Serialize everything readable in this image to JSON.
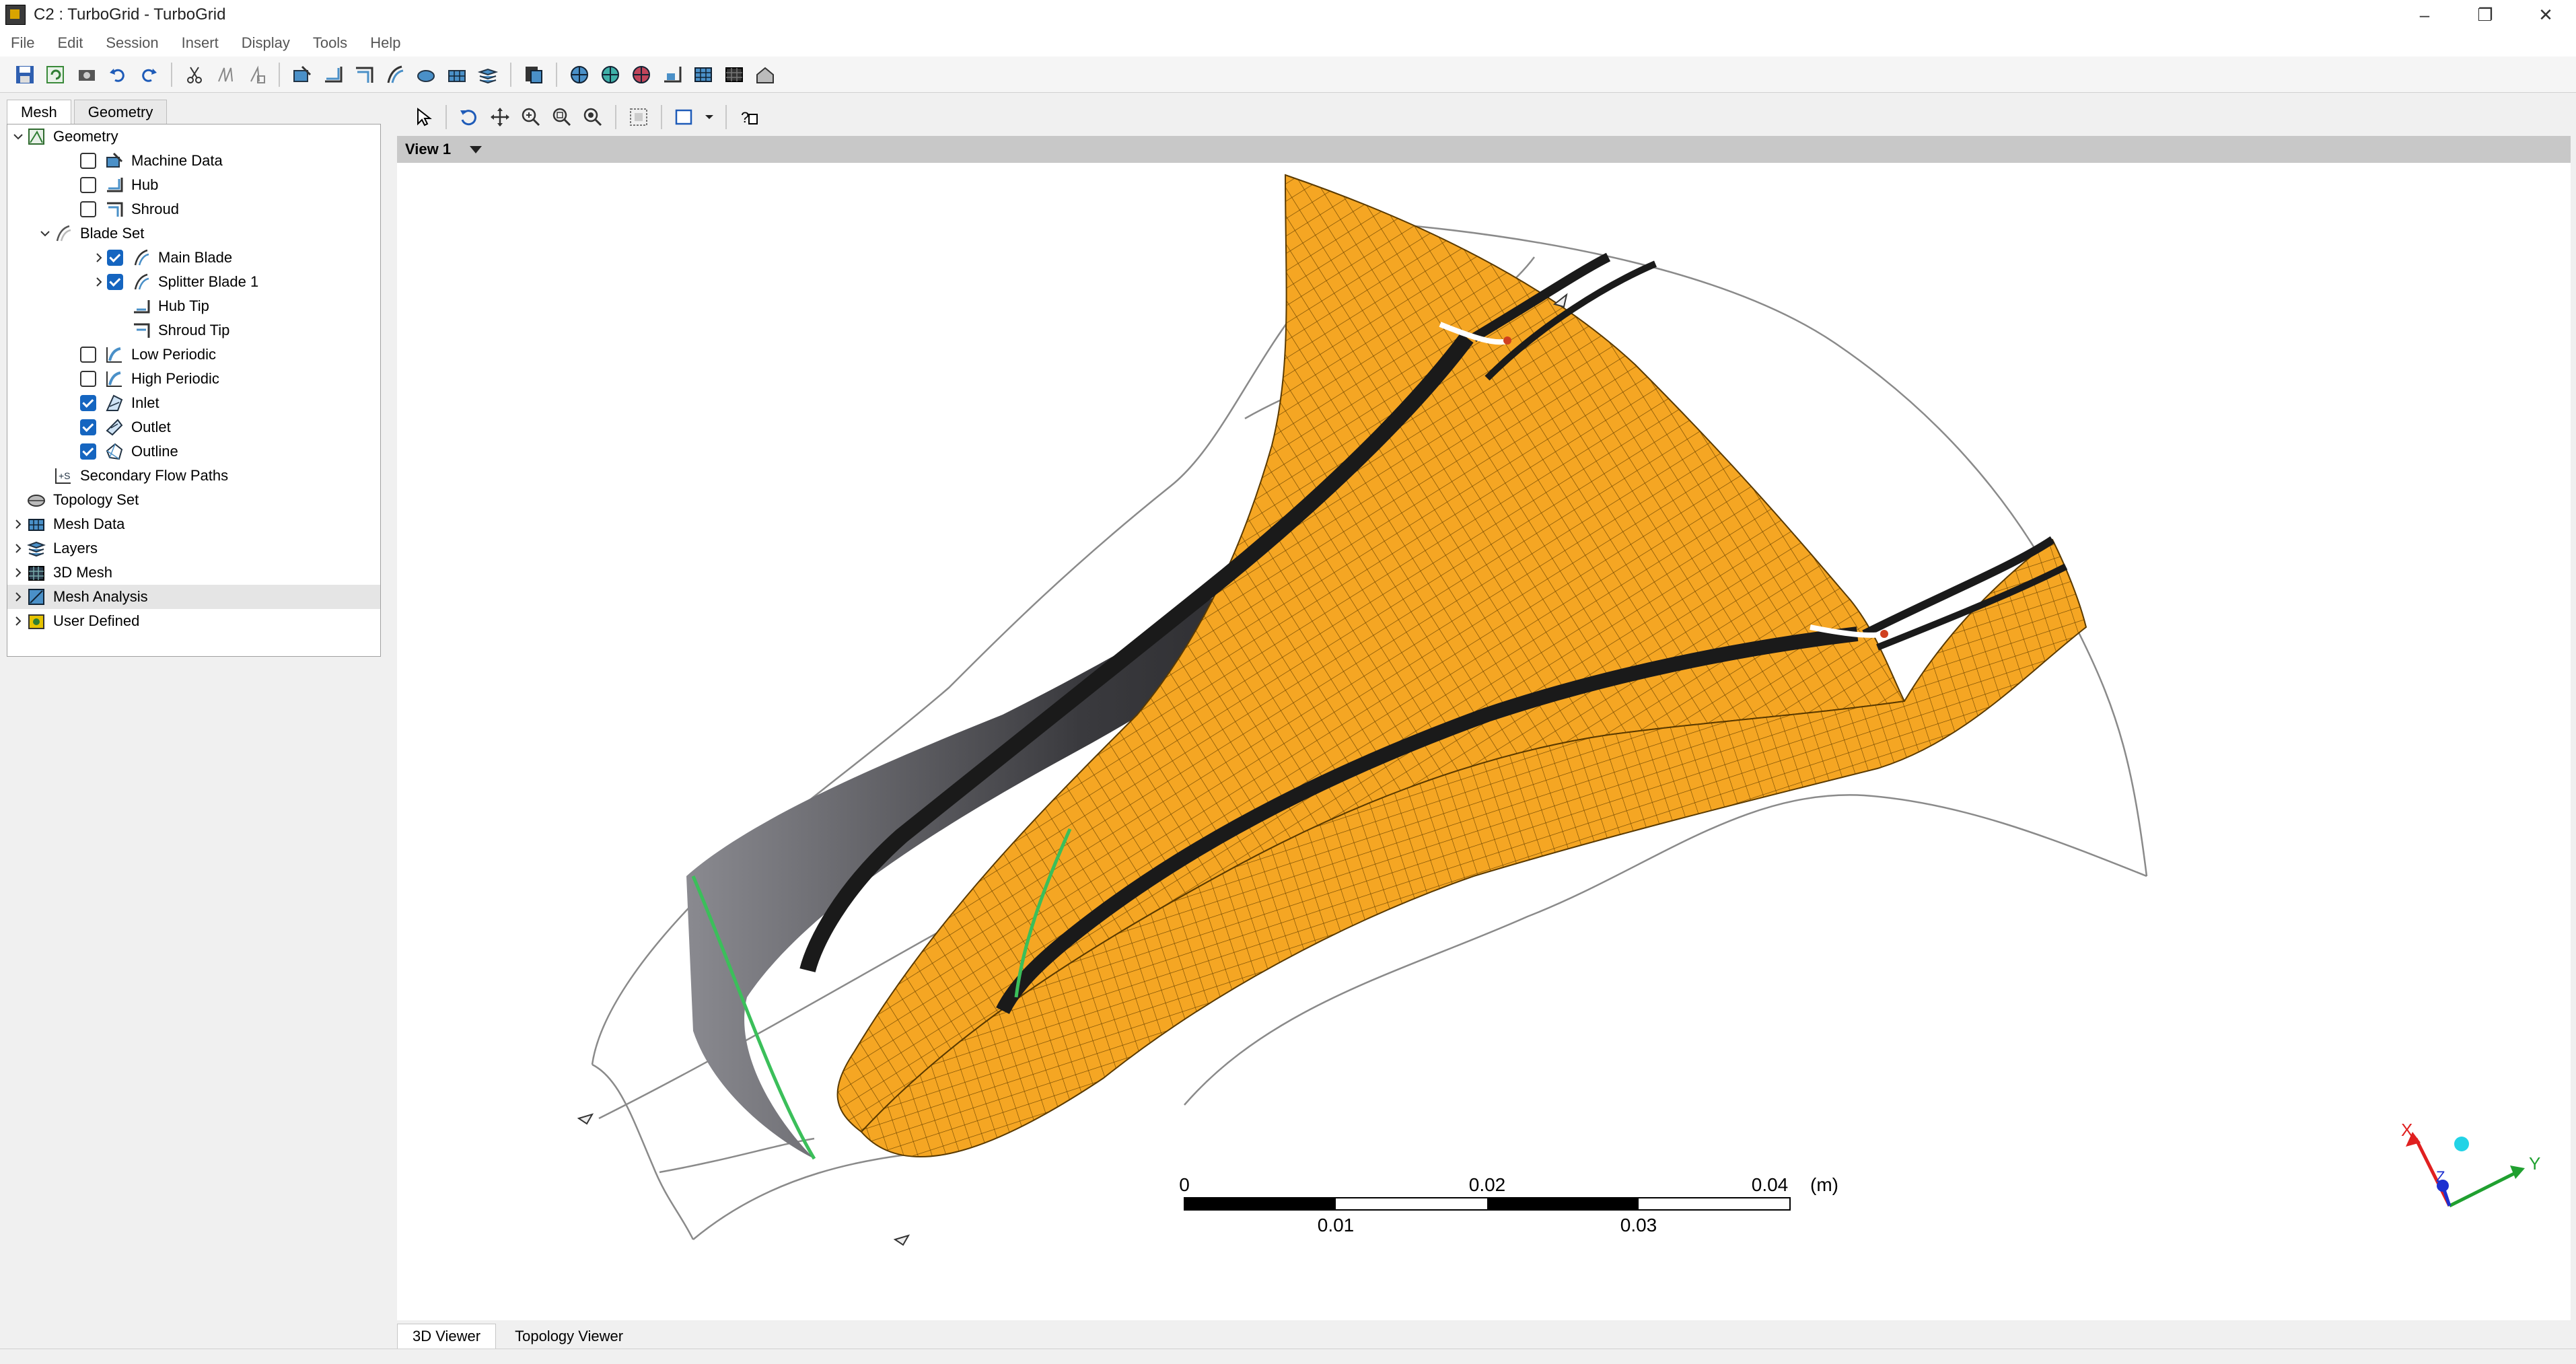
{
  "window": {
    "title": "C2 : TurboGrid - TurboGrid",
    "controls": [
      "–",
      "❐",
      "✕"
    ]
  },
  "menu": [
    "File",
    "Edit",
    "Session",
    "Insert",
    "Display",
    "Tools",
    "Help"
  ],
  "panel": {
    "tabs": [
      "Mesh",
      "Geometry"
    ],
    "tree": [
      {
        "label": "Geometry",
        "depth": 0,
        "expander": "v",
        "check": "none",
        "icon": "geometry-icon"
      },
      {
        "label": "Machine Data",
        "depth": 2,
        "expander": "",
        "check": "off",
        "icon": "machine-data-icon"
      },
      {
        "label": "Hub",
        "depth": 2,
        "expander": "",
        "check": "off",
        "icon": "hub-icon"
      },
      {
        "label": "Shroud",
        "depth": 2,
        "expander": "",
        "check": "off",
        "icon": "shroud-icon"
      },
      {
        "label": "Blade Set",
        "depth": 1,
        "expander": "v",
        "check": "none",
        "icon": "blade-set-icon"
      },
      {
        "label": "Main Blade",
        "depth": 3,
        "expander": ">",
        "check": "on",
        "icon": "blade-icon"
      },
      {
        "label": "Splitter Blade 1",
        "depth": 3,
        "expander": ">",
        "check": "on",
        "icon": "blade-icon"
      },
      {
        "label": "Hub Tip",
        "depth": 3,
        "expander": "",
        "check": "none-indent",
        "icon": "hub-tip-icon"
      },
      {
        "label": "Shroud Tip",
        "depth": 3,
        "expander": "",
        "check": "none-indent",
        "icon": "shroud-tip-icon"
      },
      {
        "label": "Low Periodic",
        "depth": 2,
        "expander": "",
        "check": "off",
        "icon": "periodic-icon"
      },
      {
        "label": "High Periodic",
        "depth": 2,
        "expander": "",
        "check": "off",
        "icon": "periodic-icon"
      },
      {
        "label": "Inlet",
        "depth": 2,
        "expander": "",
        "check": "on",
        "icon": "inlet-icon"
      },
      {
        "label": "Outlet",
        "depth": 2,
        "expander": "",
        "check": "on",
        "icon": "outlet-icon"
      },
      {
        "label": "Outline",
        "depth": 2,
        "expander": "",
        "check": "on",
        "icon": "outline-icon"
      },
      {
        "label": "Secondary Flow Paths",
        "depth": 1,
        "expander": "",
        "check": "none",
        "icon": "secondary-flow-icon"
      },
      {
        "label": "Topology Set",
        "depth": 0,
        "expander": "",
        "check": "none",
        "icon": "topology-set-icon"
      },
      {
        "label": "Mesh Data",
        "depth": 0,
        "expander": ">",
        "check": "none",
        "icon": "mesh-data-icon"
      },
      {
        "label": "Layers",
        "depth": 0,
        "expander": ">",
        "check": "none",
        "icon": "layers-icon"
      },
      {
        "label": "3D Mesh",
        "depth": 0,
        "expander": ">",
        "check": "none",
        "icon": "mesh-3d-icon"
      },
      {
        "label": "Mesh Analysis",
        "depth": 0,
        "expander": ">",
        "check": "none",
        "icon": "mesh-analysis-icon",
        "selected": true
      },
      {
        "label": "User Defined",
        "depth": 0,
        "expander": ">",
        "check": "none",
        "icon": "user-defined-icon"
      }
    ]
  },
  "viewer": {
    "view_name": "View 1",
    "bottom_tabs": [
      "3D Viewer",
      "Topology Viewer"
    ],
    "ruler": {
      "top_labels": [
        "0",
        "0.02",
        "0.04"
      ],
      "bottom_labels": [
        "0.01",
        "0.03"
      ],
      "unit": "(m)"
    },
    "triad": {
      "x": "X",
      "y": "Y",
      "z": "Z"
    }
  },
  "colors": {
    "mesh_fill": "#F5A623",
    "mesh_line": "#5a3a00",
    "blade_dark": "#2b2b2e",
    "outline": "#8a8a8a",
    "check_on": "#1565C0"
  }
}
